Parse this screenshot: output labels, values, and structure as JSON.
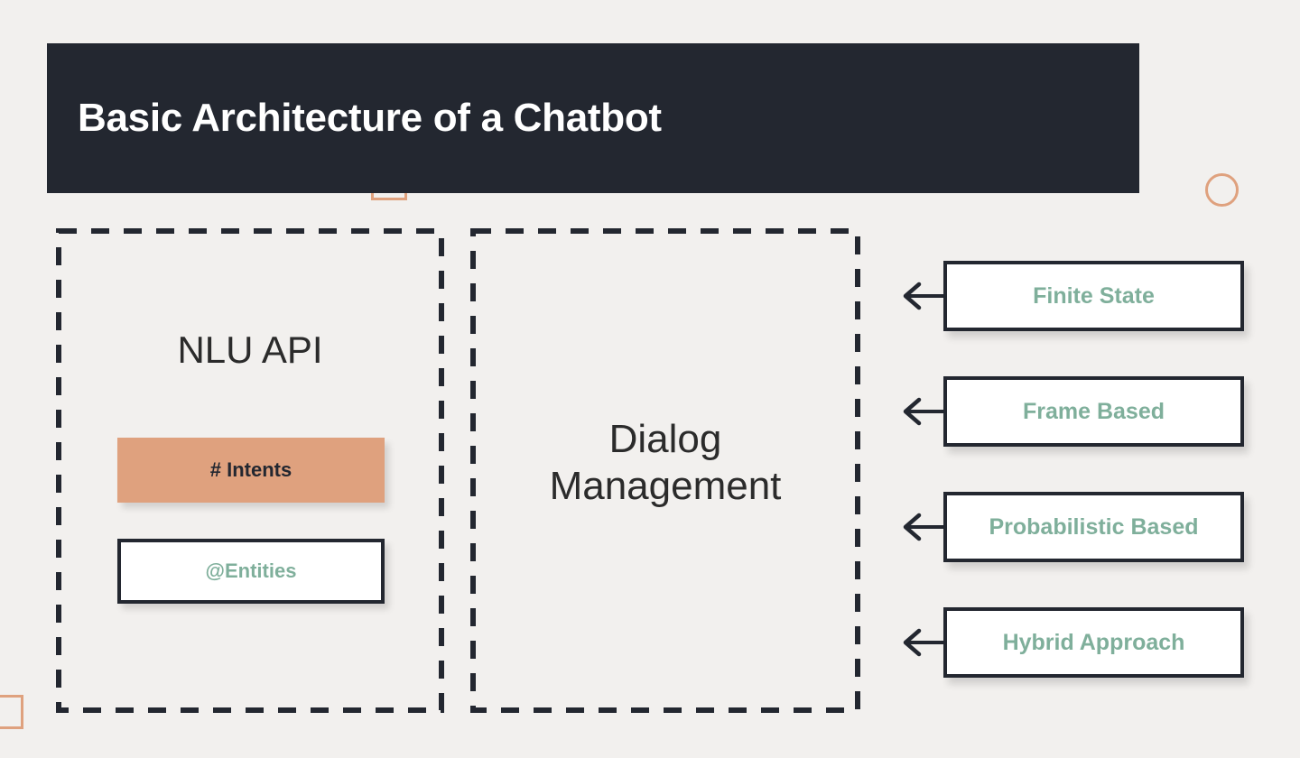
{
  "slide": {
    "background_color": "#F2F0EE",
    "header": {
      "title": "Basic Architecture of a Chatbot",
      "background_color": "#232730",
      "text_color": "#FFFFFF"
    },
    "decorations": [
      {
        "name": "square-outline-top",
        "color": "#DFA17E",
        "shape": "square"
      },
      {
        "name": "circle-outline-right",
        "color": "#DFA17E",
        "shape": "circle"
      },
      {
        "name": "square-outline-bottom-left",
        "color": "#DFA17E",
        "shape": "square"
      }
    ]
  },
  "panels": [
    {
      "id": "nlu",
      "heading": "NLU API",
      "chips": [
        {
          "id": "intents",
          "label": "# Intents",
          "background_color": "#DFA17E",
          "text_color": "#232730",
          "bordered": false
        },
        {
          "id": "entities",
          "label": "@Entities",
          "background_color": "#FFFFFF",
          "text_color": "#7FAF9B",
          "bordered": true
        }
      ]
    },
    {
      "id": "dialog",
      "heading": "Dialog Management",
      "heading_line_1": "Dialog",
      "heading_line_2": "Management",
      "chips": []
    }
  ],
  "options": {
    "accent_color": "#7FAF9B",
    "border_color": "#232730",
    "items": [
      {
        "label": "Finite State"
      },
      {
        "label": "Frame Based"
      },
      {
        "label": "Probabilistic Based"
      },
      {
        "label": "Hybrid Approach"
      }
    ]
  }
}
